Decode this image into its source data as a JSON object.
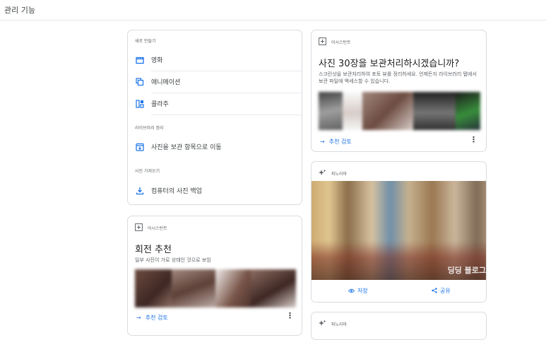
{
  "header": {
    "title": "관리 기능"
  },
  "tools_card": {
    "create_section": "새로 만들기",
    "items_create": [
      {
        "label": "영화",
        "icon": "movie-icon"
      },
      {
        "label": "애니메이션",
        "icon": "animation-icon"
      },
      {
        "label": "콜라주",
        "icon": "collage-icon"
      }
    ],
    "library_section": "라이브러리 정리",
    "archive_label": "사진을 보관 항목으로 이동",
    "import_section": "사진 가져오기",
    "backup_label": "컴퓨터의 사진 백업"
  },
  "rotate_card": {
    "badge": "어시스턴트",
    "title": "회전 추천",
    "description": "일부 사진이 가로 상태인 것으로 보임",
    "action": "추천 검토"
  },
  "archive_card": {
    "badge": "어시스턴트",
    "title": "사진 30장을 보관처리하시겠습니까?",
    "description": "스크린샷을 보관처리하여 포토 뷰를 정리하세요. 언제든지 라이브러리 탭에서 보관 파일에 액세스할 수 있습니다.",
    "action": "추천 검토"
  },
  "pano_card": {
    "badge": "파노라마",
    "watermark": "딩딩 블로그",
    "save_label": "저장",
    "share_label": "공유"
  },
  "pano_card_2": {
    "badge": "파노라마"
  },
  "colors": {
    "accent": "#1a73e8",
    "border": "#dadce0",
    "text_secondary": "#5f6368"
  }
}
